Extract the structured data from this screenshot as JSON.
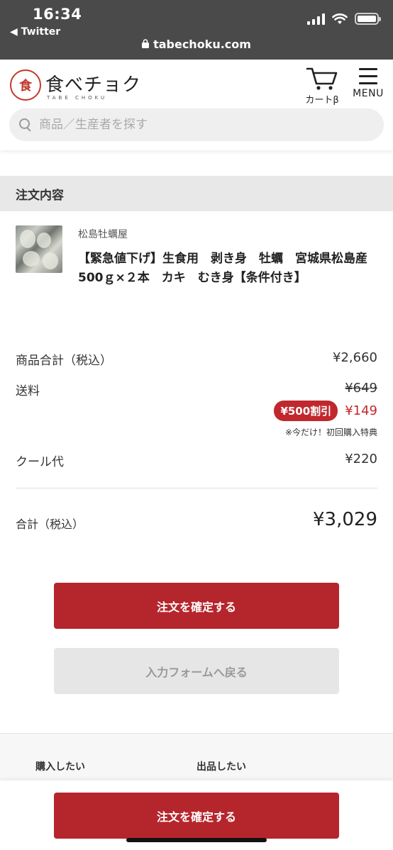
{
  "status": {
    "time": "16:34",
    "back_app": "◀ Twitter",
    "url": "tabechoku.com"
  },
  "header": {
    "logo_mark": "食",
    "logo_text": "食べチョク",
    "logo_sub": "TABE CHOKU",
    "cart_label": "カートβ",
    "menu_label": "MENU",
    "search_placeholder": "商品／生産者を探す"
  },
  "order": {
    "section_title": "注文内容",
    "product": {
      "seller": "松島牡蠣屋",
      "name": "【緊急値下げ】生食用　剥き身　牡蠣　宮城県松島産　500ｇ×２本　カキ　むき身【条件付き】"
    },
    "subtotal_label": "商品合計（税込）",
    "subtotal_value": "¥2,660",
    "shipping_label": "送料",
    "shipping_original": "¥649",
    "shipping_discount_badge": "¥500割引",
    "shipping_value": "¥149",
    "shipping_note": "※今だけ！初回購入特典",
    "cool_label": "クール代",
    "cool_value": "¥220",
    "total_label": "合計（税込）",
    "total_value": "¥3,029"
  },
  "actions": {
    "confirm_label": "注文を確定する",
    "back_label": "入力フォームへ戻る",
    "sticky_confirm_label": "注文を確定する"
  },
  "footer": {
    "col1": "購入したい",
    "col2": "出品したい"
  },
  "colors": {
    "accent": "#b5262c",
    "status_bar": "#4a4a4a"
  }
}
